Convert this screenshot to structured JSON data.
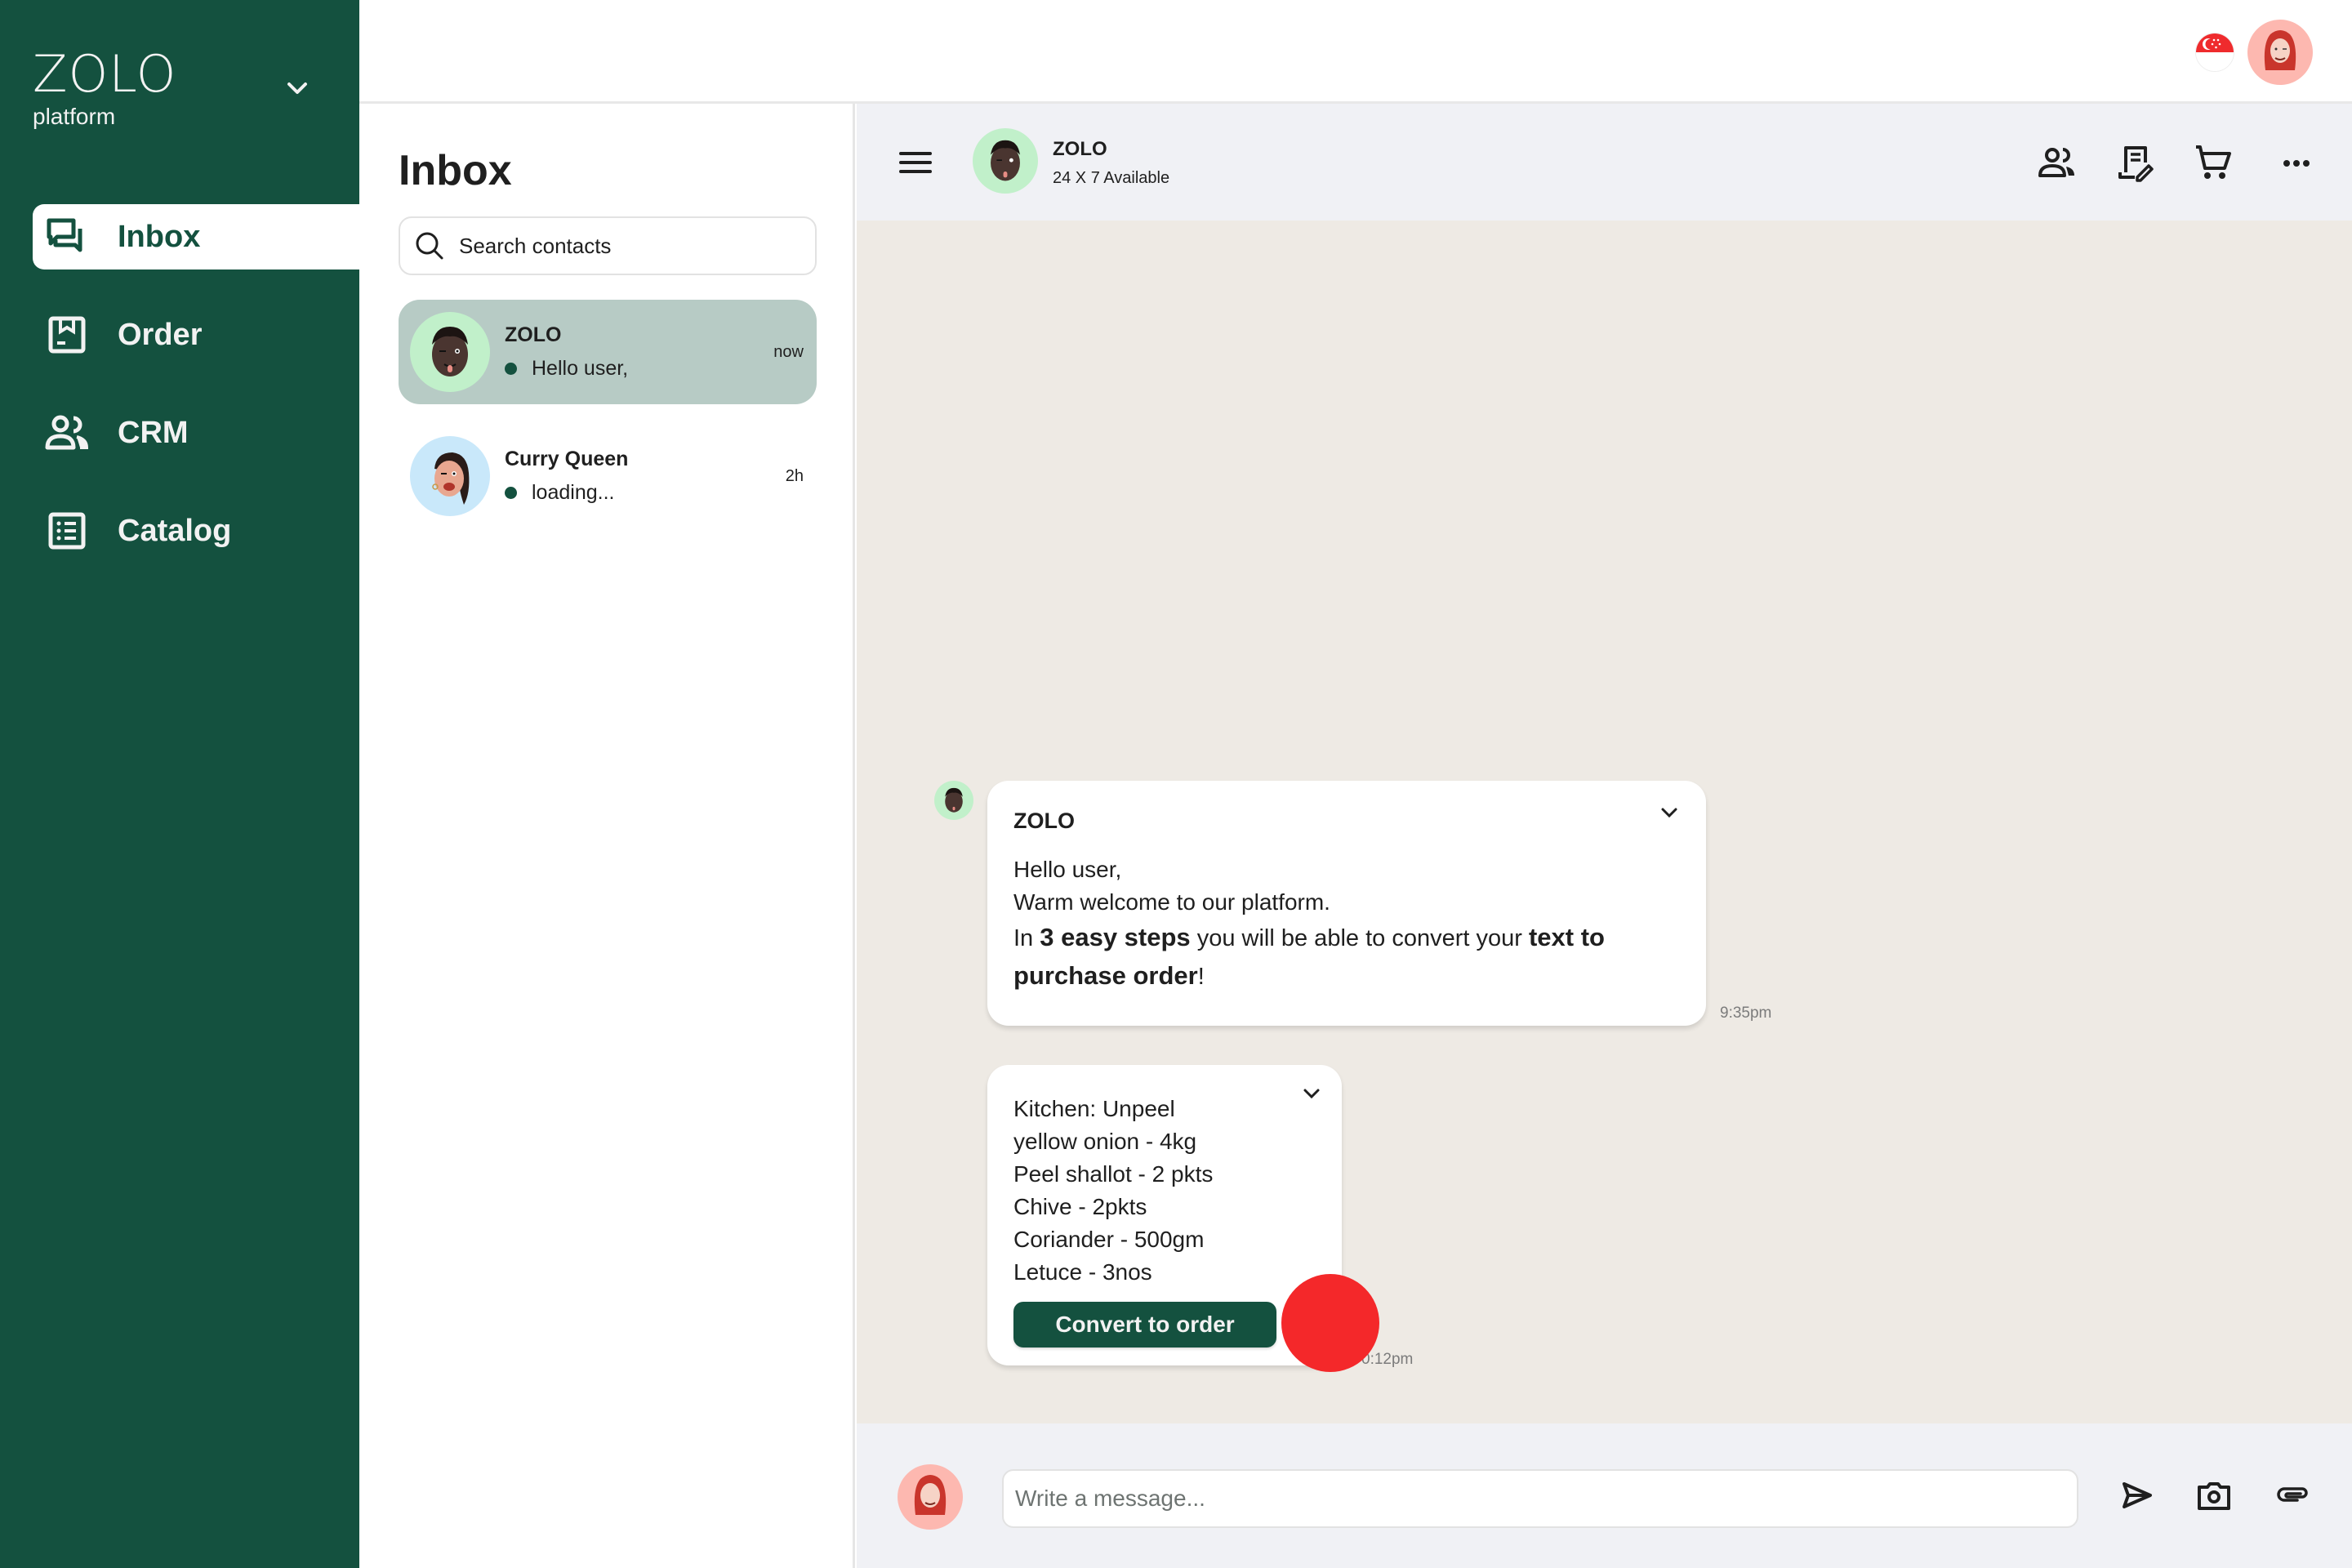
{
  "brand": {
    "title": "ZOLO",
    "subtitle": "platform",
    "color": "#14513F"
  },
  "sidebar": {
    "items": [
      {
        "label": "Inbox",
        "icon": "chat-bubbles-icon",
        "active": true
      },
      {
        "label": "Order",
        "icon": "package-icon",
        "active": false
      },
      {
        "label": "CRM",
        "icon": "people-icon",
        "active": false
      },
      {
        "label": "Catalog",
        "icon": "list-icon",
        "active": false
      }
    ]
  },
  "topbar": {
    "region_flag": "singapore-flag-icon",
    "user_avatar": "user-avatar"
  },
  "inbox": {
    "title": "Inbox",
    "search_placeholder": "Search contacts",
    "contacts": [
      {
        "name": "ZOLO",
        "preview": "Hello user,",
        "time": "now",
        "online": true,
        "active": true,
        "avatar_bg": "#C1F0CA"
      },
      {
        "name": "Curry Queen",
        "preview": "loading...",
        "time": "2h",
        "online": true,
        "active": false,
        "avatar_bg": "#C9E8FA"
      }
    ]
  },
  "chat": {
    "header": {
      "name": "ZOLO",
      "status": "24 X 7 Available"
    },
    "header_actions": [
      "people-icon",
      "receipt-edit-icon",
      "cart-icon",
      "more-icon"
    ],
    "messages": [
      {
        "sender": "ZOLO",
        "line1": "Hello user,",
        "line2": "Warm welcome to our platform.",
        "line3_parts": {
          "p1": "In ",
          "b1": "3 easy steps",
          "p2": " you will be able to convert your ",
          "b2": "text to purchase order",
          "p3": "!"
        },
        "time": "9:35pm"
      },
      {
        "lines": [
          "Kitchen: Unpeel",
          "yellow onion - 4kg",
          "Peel shallot - 2 pkts",
          "Chive - 2pkts",
          "Coriander - 500gm",
          "Letuce - 3nos"
        ],
        "button_label": "Convert to order",
        "time": "0:12pm"
      }
    ]
  },
  "composer": {
    "placeholder": "Write a message..."
  },
  "colors": {
    "sidebar": "#14513F",
    "active_contact": "#B7CBC5",
    "chat_bg": "#EEEAE4",
    "header_bg": "#F0F1F5",
    "cursor_marker": "#F4282A"
  }
}
